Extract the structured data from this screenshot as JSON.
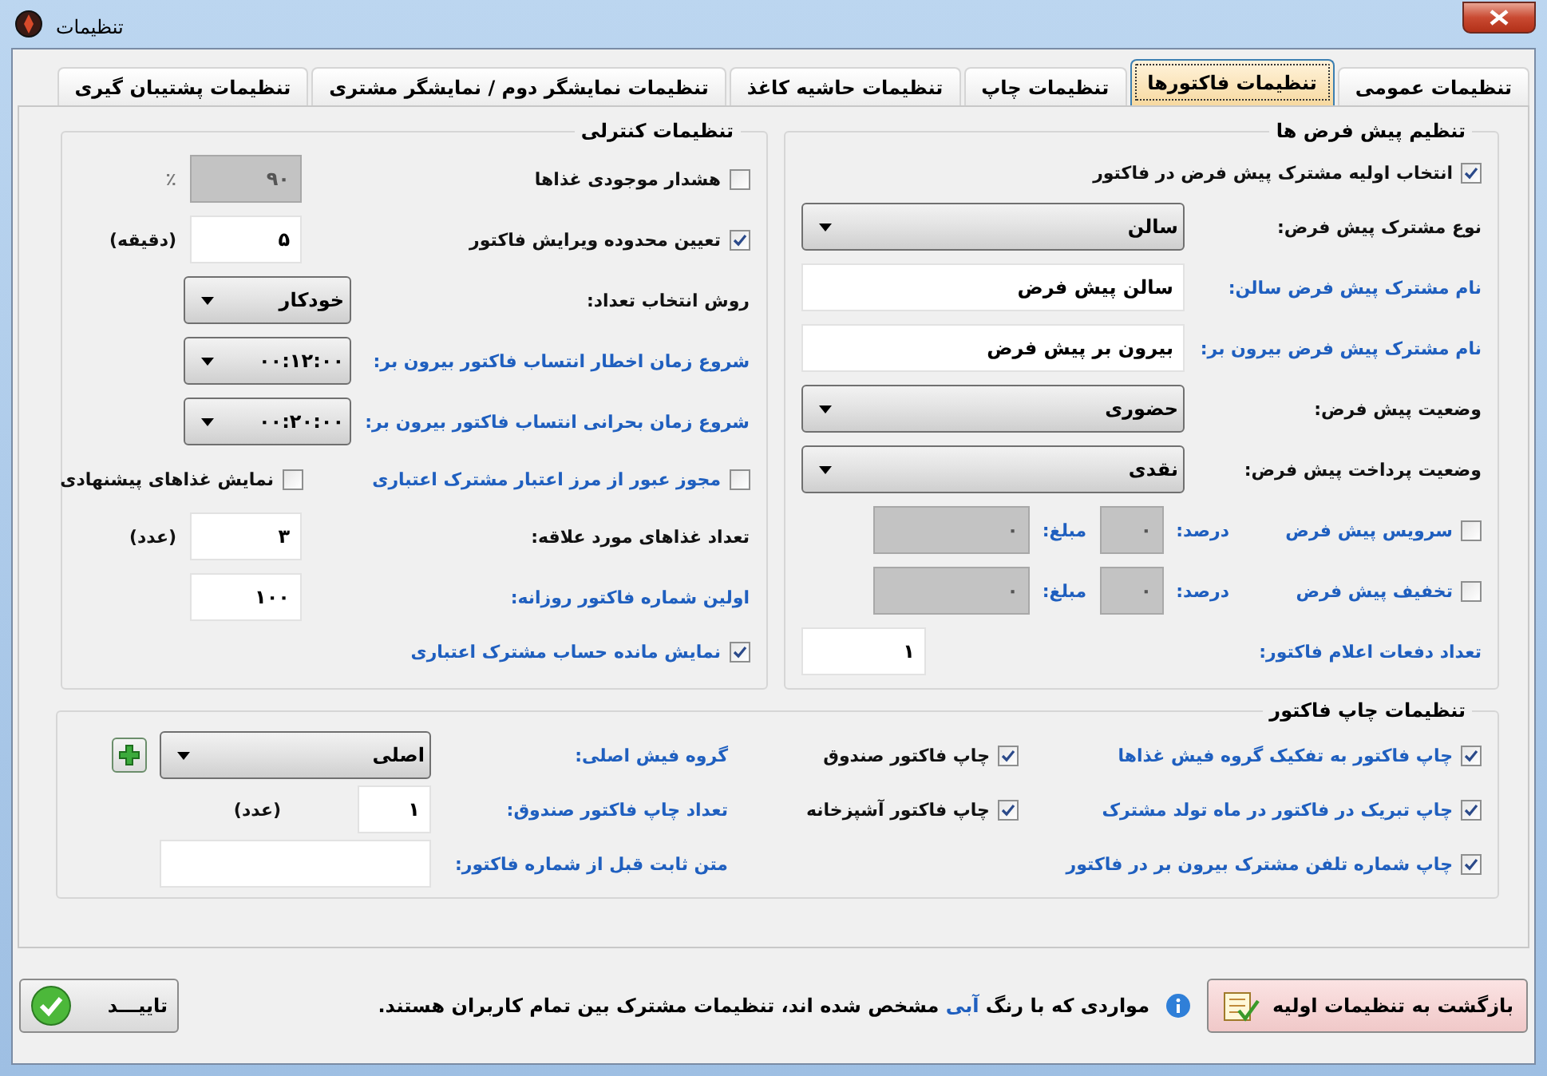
{
  "window": {
    "title": "تنظیمات"
  },
  "tabs": [
    {
      "label": "تنظیمات عمومی",
      "selected": false
    },
    {
      "label": "تنظیمات فاکتورها",
      "selected": true
    },
    {
      "label": "تنظیمات چاپ",
      "selected": false
    },
    {
      "label": "تنظیمات حاشیه کاغذ",
      "selected": false
    },
    {
      "label": "تنظیمات نمایشگر دوم / نمایشگر مشتری",
      "selected": false
    },
    {
      "label": "تنظیمات پشتیبان گیری",
      "selected": false
    }
  ],
  "defaults": {
    "title": "تنظیم پیش فرض ها",
    "rows": [
      {
        "kind": "checkbox",
        "label": "انتخاب اولیه مشترک پیش فرض در فاکتور",
        "checked": true,
        "shared": false
      },
      {
        "kind": "select",
        "label": "نوع مشترک پیش فرض:",
        "value": "سالن",
        "shared": false
      },
      {
        "kind": "text",
        "label": "نام مشترک پیش فرض سالن:",
        "value": "سالن پیش فرض",
        "shared": true
      },
      {
        "kind": "text",
        "label": "نام مشترک پیش فرض بیرون بر:",
        "value": "بیرون بر پیش فرض",
        "shared": true
      },
      {
        "kind": "select",
        "label": "وضعیت پیش فرض:",
        "value": "حضوری",
        "shared": false
      },
      {
        "kind": "select",
        "label": "وضعیت پرداخت پیش فرض:",
        "value": "نقدی",
        "shared": false
      },
      {
        "kind": "charge",
        "label": "سرویس پیش فرض",
        "checked": false,
        "shared": true,
        "percent_label": "درصد:",
        "percent": "۰",
        "amount_label": "مبلغ:",
        "amount": "۰"
      },
      {
        "kind": "charge",
        "label": "تخفیف پیش فرض",
        "checked": false,
        "shared": true,
        "percent_label": "درصد:",
        "percent": "۰",
        "amount_label": "مبلغ:",
        "amount": "۰"
      },
      {
        "kind": "number",
        "label": "تعداد دفعات اعلام فاکتور:",
        "value": "۱",
        "shared": true
      }
    ]
  },
  "control": {
    "title": "تنظیمات کنترلی",
    "rows": [
      {
        "kind": "check_number",
        "label": "هشدار موجودی غذاها",
        "checked": false,
        "shared": false,
        "value": "۹۰",
        "unit": "٪",
        "disabled": true
      },
      {
        "kind": "check_number",
        "label": "تعیین محدوده ویرایش فاکتور",
        "checked": true,
        "shared": false,
        "value": "۵",
        "unit": "(دقیقه)",
        "disabled": false
      },
      {
        "kind": "select",
        "label": "روش انتخاب تعداد:",
        "value": "خودکار",
        "shared": false
      },
      {
        "kind": "select",
        "label": "شروع زمان اخطار انتساب فاکتور بیرون بر:",
        "value": "۰۰:۱۲:۰۰",
        "shared": true
      },
      {
        "kind": "select",
        "label": "شروع زمان بحرانی انتساب فاکتور بیرون بر:",
        "value": "۰۰:۲۰:۰۰",
        "shared": true
      },
      {
        "kind": "check_pair",
        "items": [
          {
            "label": "مجوز عبور از مرز اعتبار مشترک اعتباری",
            "checked": false,
            "shared": true
          },
          {
            "label": "نمایش غذاهای پیشنهادی",
            "checked": false,
            "shared": false
          }
        ]
      },
      {
        "kind": "number",
        "label": "تعداد غذاهای مورد علاقه:",
        "value": "۳",
        "unit": "(عدد)",
        "shared": false
      },
      {
        "kind": "number",
        "label": "اولین شماره فاکتور روزانه:",
        "value": "۱۰۰",
        "shared": true
      },
      {
        "kind": "checkbox",
        "label": "نمایش مانده حساب مشترک اعتباری",
        "checked": true,
        "shared": true
      }
    ]
  },
  "print": {
    "title": "تنظیمات چاپ فاکتور",
    "checks_a": [
      {
        "label": "چاپ فاکتور به تفکیک گروه فیش غذاها",
        "checked": true,
        "shared": true
      },
      {
        "label": "چاپ تبریک در فاکتور در ماه تولد مشترک",
        "checked": true,
        "shared": true
      },
      {
        "label": "چاپ شماره تلفن مشترک بیرون بر در فاکتور",
        "checked": true,
        "shared": true
      }
    ],
    "checks_b": [
      {
        "label": "چاپ فاکتور صندوق",
        "checked": true,
        "shared": false
      },
      {
        "label": "چاپ فاکتور آشپزخانه",
        "checked": true,
        "shared": false
      }
    ],
    "fields": [
      {
        "kind": "select",
        "label": "گروه فیش اصلی:",
        "value": "اصلی",
        "shared": true,
        "add": true
      },
      {
        "kind": "number",
        "label": "تعداد چاپ فاکتور صندوق:",
        "value": "۱",
        "unit": "(عدد)",
        "shared": true
      },
      {
        "kind": "text",
        "label": "متن ثابت قبل از شماره فاکتور:",
        "shared": true
      }
    ]
  },
  "footer": {
    "reset_button": "بازگشت به تنظیمات اولیه",
    "note_before": "مواردی که با رنگ",
    "note_highlight": "آبی",
    "note_after": "مشخص شده اند، تنظیمات مشترک بین تمام کاربران هستند.",
    "ok_button": "تاییـــد"
  }
}
